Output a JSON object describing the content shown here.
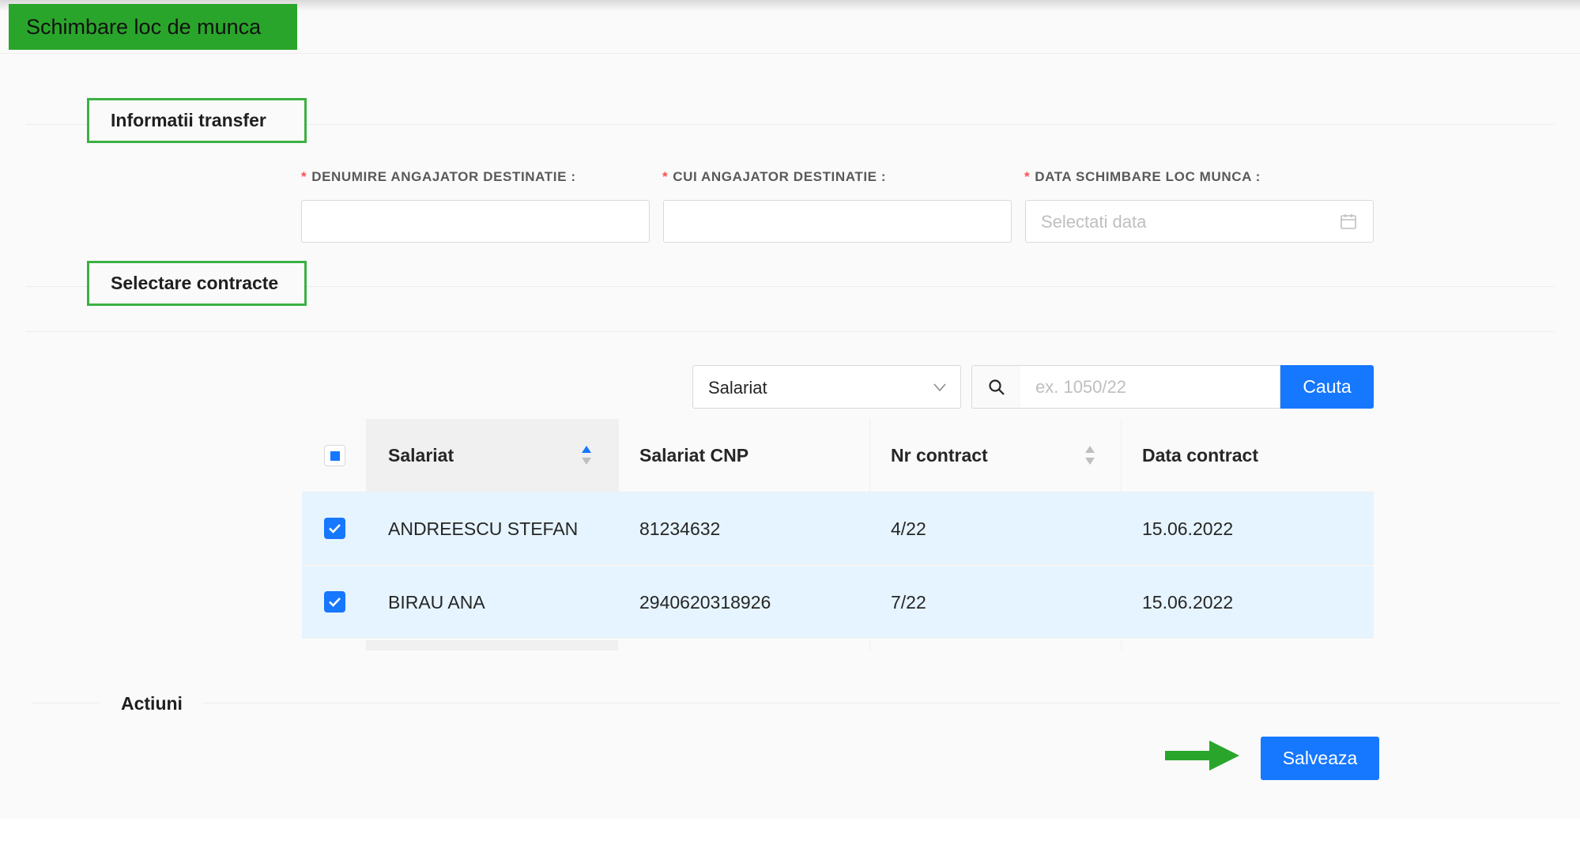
{
  "page": {
    "title": "Schimbare loc de munca"
  },
  "sections": {
    "transfer": "Informatii transfer",
    "contracts": "Selectare contracte",
    "actions": "Actiuni"
  },
  "fields": [
    {
      "label": "DENUMIRE ANGAJATOR DESTINATIE :",
      "value": "",
      "required": true
    },
    {
      "label": "CUI ANGAJATOR DESTINATIE :",
      "value": "",
      "required": true
    },
    {
      "label": "DATA SCHIMBARE LOC MUNCA :",
      "placeholder": "Selectati data",
      "required": true,
      "icon": "calendar-icon"
    }
  ],
  "required_mark": "*",
  "filter": {
    "select_value": "Salariat",
    "search_placeholder": "ex. 1050/22",
    "search_button": "Cauta"
  },
  "table": {
    "columns": [
      "Salariat",
      "Salariat CNP",
      "Nr contract",
      "Data contract"
    ],
    "header_checkbox": "indeterminate",
    "rows": [
      {
        "checked": true,
        "salariat": "ANDREESCU STEFAN",
        "cnp": "81234632",
        "nr_contract": "4/22",
        "data_contract": "15.06.2022"
      },
      {
        "checked": true,
        "salariat": "BIRAU ANA",
        "cnp": "2940620318926",
        "nr_contract": "7/22",
        "data_contract": "15.06.2022"
      }
    ]
  },
  "save_button": "Salveaza",
  "colors": {
    "primary": "#1677ff",
    "title_bg": "#2aa52b",
    "highlight_border": "#3cb043",
    "row_selected": "#e6f4ff",
    "required": "#ff4d4f"
  }
}
